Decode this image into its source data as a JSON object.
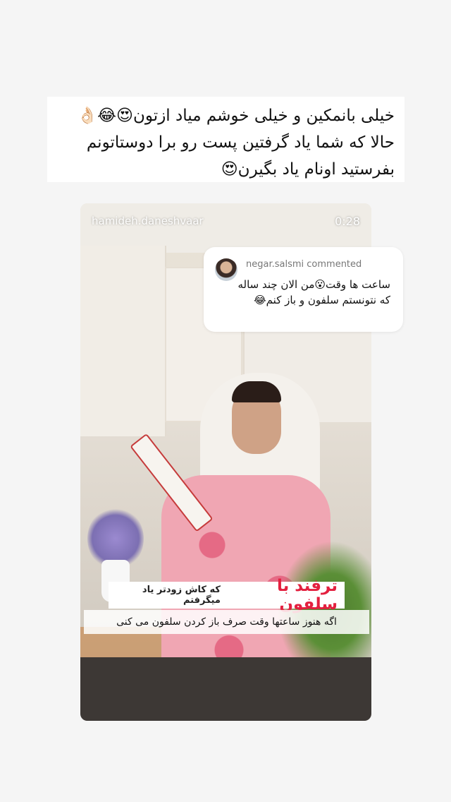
{
  "caption": {
    "line1": "خیلی بانمکین و خیلی خوشم میاد ازتون😍😂👌🏻",
    "line2": "حالا که شما یاد گرفتین پست رو برا دوستاتونم",
    "line3": "بفرستید اونام یاد بگیرن😍"
  },
  "video": {
    "username": "hamideh.daneshvaar",
    "timestamp": "0:28",
    "overlay_title_red": "ترفند با سلفون",
    "overlay_title_black": "که کاش زودتر یاد میگرفتم",
    "overlay_subtitle": "اگه هنوز ساعتها وقت صرف باز کردن سلفون می کنی"
  },
  "comment": {
    "username": "negar.salsmi commented",
    "text": "ساعت ها وقت😮من الان چند ساله که نتونستم سلفون و باز کنم😂"
  }
}
